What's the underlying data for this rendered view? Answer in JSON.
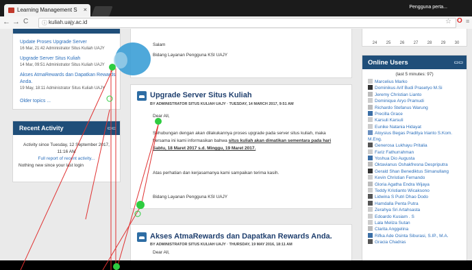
{
  "browser": {
    "tab_title": "Learning Management S",
    "tab_close": "×",
    "profile": "Pengguna perta...",
    "url": "kuliah.uajy.ac.id",
    "back": "←",
    "forward": "→",
    "reload": "C",
    "star": "☆",
    "opera": "O",
    "menu": "≡"
  },
  "left": {
    "news": [
      {
        "title": "Update Proses Upgrade Server",
        "meta": "16 Mar, 21:42  Administrator Situs Kuliah UAJY"
      },
      {
        "title": "Upgrade Server Situs Kuliah",
        "meta": "14 Mar, 09:51  Administrator Situs Kuliah UAJY"
      },
      {
        "title": "Akses AtmaRewards dan Dapatkan Rewards",
        "title2": "Anda.",
        "meta": "19 May, 18:11  Administrator Situs Kuliah UAJY"
      }
    ],
    "older": "Older topics ...",
    "recent": {
      "title": "Recent Activity",
      "since_line1": "Activity since Tuesday, 12 September 2017,",
      "since_line2": "11:16 AM",
      "full_report": "Full report of recent activity...",
      "nothing": "Nothing new since your last login"
    }
  },
  "main": {
    "top": {
      "salam": "Salam",
      "sign": "Bidang Layanan Pengguna KSI UAJY"
    },
    "post1": {
      "title": "Upgrade Server Situs Kuliah",
      "meta": "BY ADMINISTRATOR SITUS KULIAH UAJY · TUESDAY, 14 MARCH 2017, 9:51 AM",
      "greeting": "Dear All,",
      "line1": "Sehubungan dengan akan dilakukannya proses upgrade pada server situs kuliah, maka",
      "line2a": "bersama ini kami informasikan bahwa ",
      "line2b": "situs kuliah akan dimatikan sementara pada hari",
      "line3": "Sabtu, 18 Maret 2017 s.d. Minggu, 19 Maret 2017.",
      "thanks": "Atas perhatian dan kerjasamanya kami sampaikan terima kasih.",
      "sign": "Bidang Layanan Pengguna KSI UAJY"
    },
    "post2": {
      "title": "Akses AtmaRewards dan Dapatkan Rewards Anda.",
      "meta": "BY ADMINISTRATOR SITUS KULIAH UAJY · THURSDAY, 19 MAY 2016, 18:11 AM",
      "greeting": "Dear All,"
    }
  },
  "right": {
    "calendar": [
      "24",
      "25",
      "26",
      "27",
      "28",
      "29",
      "30"
    ],
    "online": {
      "title": "Online Users",
      "subtitle": "(last 5 minutes: 97)",
      "users": [
        "Marcelius Marko",
        "Dominikus Arif Budi Prasetyo M.Si",
        "Jeremy Christian Lianto",
        "Dominique Aryo Pramudi",
        "Richardo Stefanus Warung",
        "Precilla Grace",
        "Karsuli Karsuli",
        "Eunike Natania Hidayat",
        "Aloysius Begas Praditya Irianto S.Kom. M.Eng.",
        "Generosa Lukhayu Pritalia",
        "Fariz Fathurrahman",
        "Yoshua Dio Augusta",
        "Oktavianus Oshakfresna Despriputra",
        "Gerald Shan Benediktus Simanullang",
        "Kevin Christian Fernando",
        "Gloria Agatha Endra Wijaya",
        "Teddy Kristianto Wicaksono",
        "Lidwina S Putri Dhao Dodo",
        "Hamdalla Penta Putra",
        "Zerahya Sri Artahsasta",
        "Edoardo Kusiam . S",
        "Lala Meliza Sutan",
        "Clarita Anggelina",
        "Rifka Ade Osinta Siburasi, S.IP., M.A.",
        "Gracia Chadras"
      ]
    }
  }
}
